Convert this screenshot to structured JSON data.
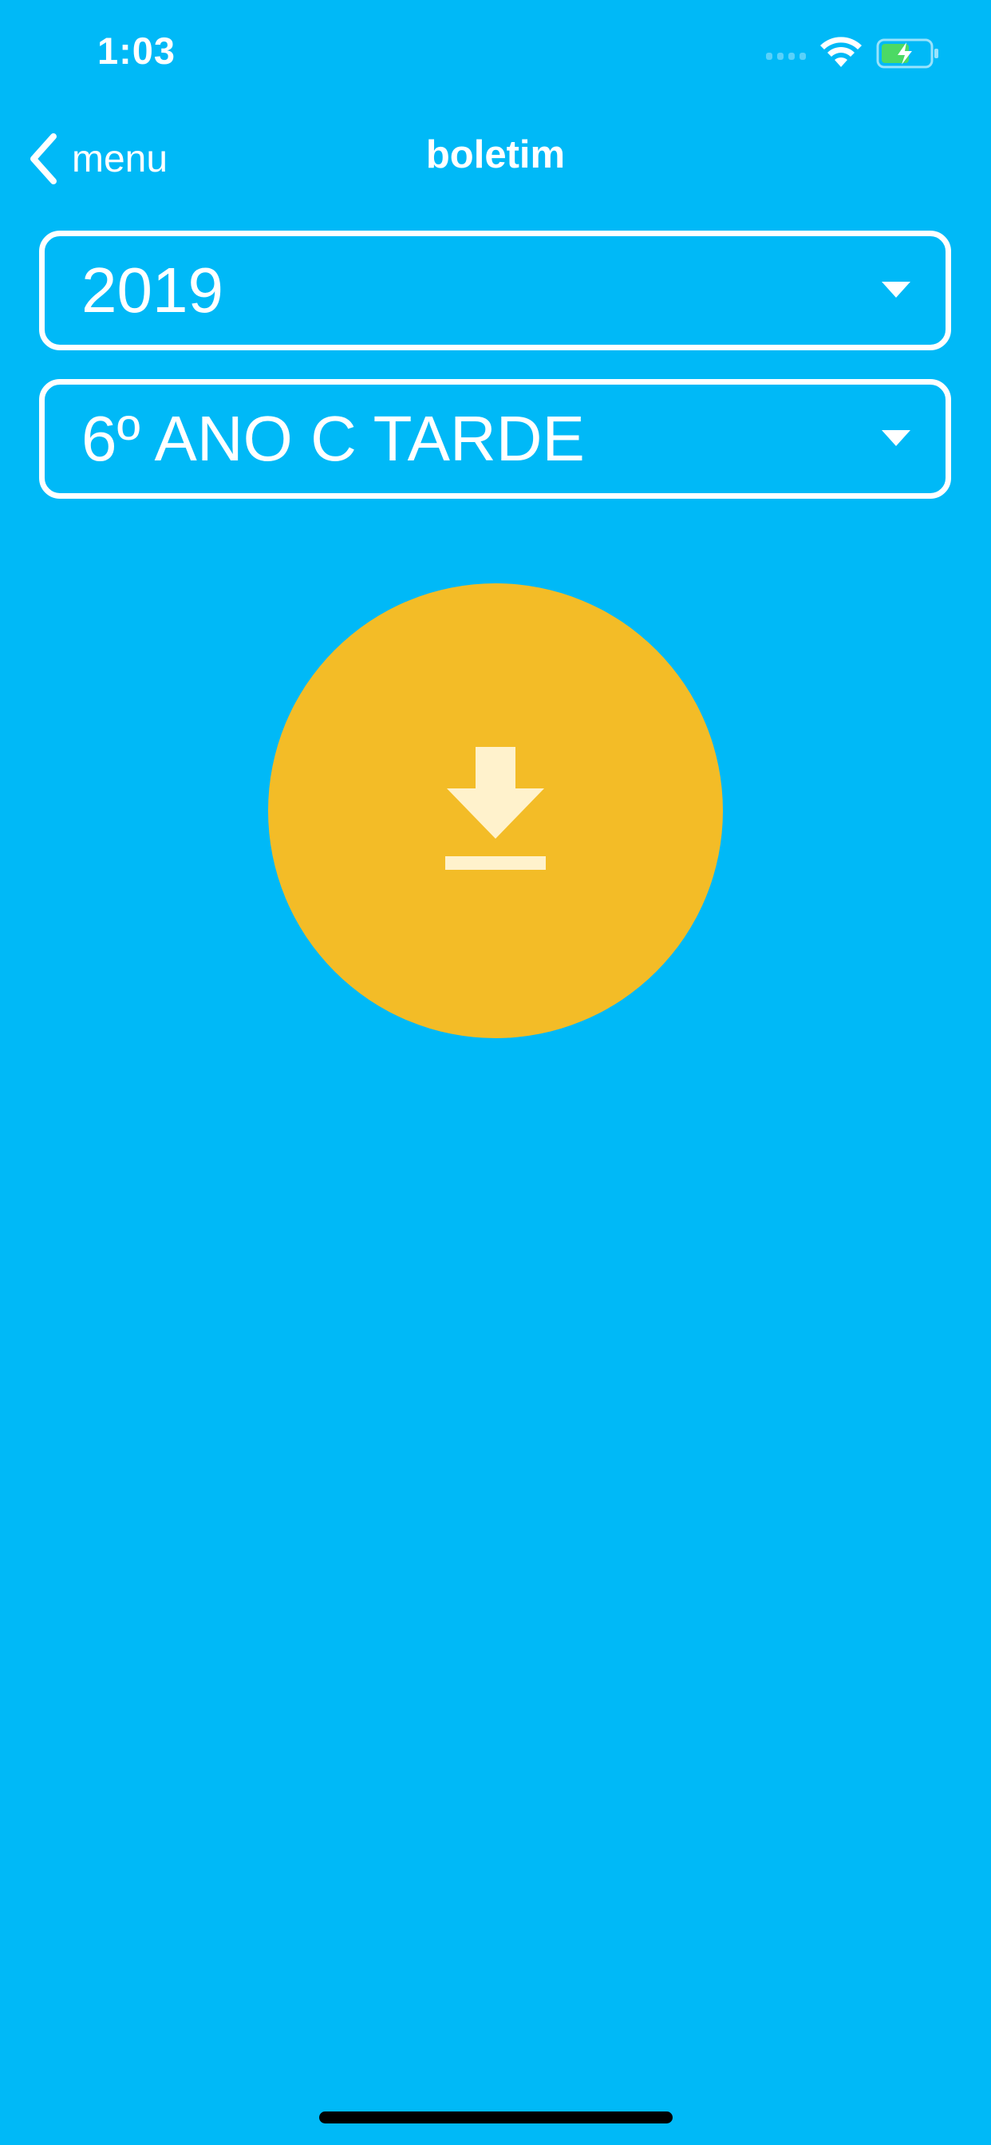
{
  "status_bar": {
    "time": "1:03",
    "icons": [
      "signal-icon",
      "wifi-icon",
      "battery-charging-icon"
    ]
  },
  "nav": {
    "back_label": "menu",
    "title": "boletim"
  },
  "filters": {
    "year": "2019",
    "class": "6º ANO C TARDE"
  },
  "actions": {
    "download_icon": "download-icon"
  },
  "colors": {
    "background": "#00b9f7",
    "download_button": "#f3bc27",
    "download_icon": "#fff2cc",
    "battery_fill": "#4cd964"
  }
}
